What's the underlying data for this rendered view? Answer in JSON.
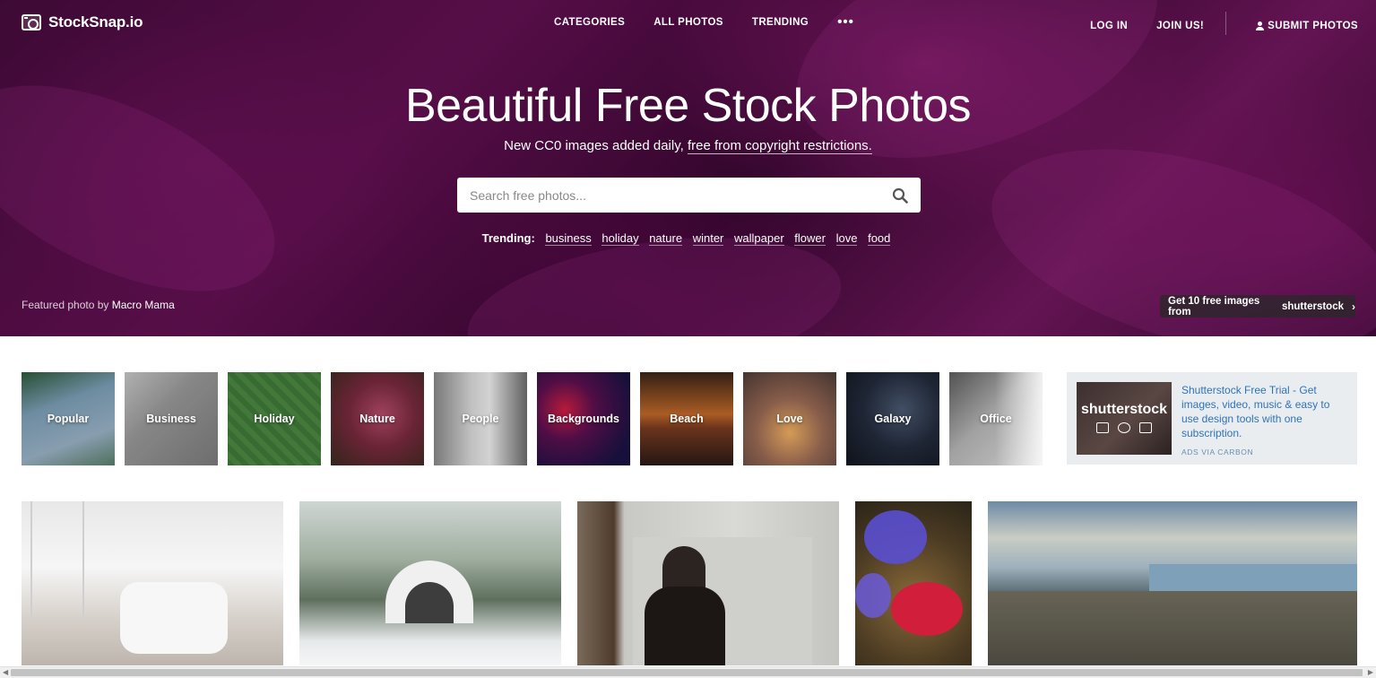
{
  "nav": {
    "logo": "StockSnap.io",
    "center": [
      "CATEGORIES",
      "ALL PHOTOS",
      "TRENDING"
    ],
    "more": "•••",
    "login": "LOG IN",
    "join": "JOIN US!",
    "submit": "SUBMIT PHOTOS"
  },
  "hero": {
    "title": "Beautiful Free Stock Photos",
    "subtitle_prefix": "New CC0 images added daily, ",
    "subtitle_link": "free from copyright restrictions.",
    "search_placeholder": "Search free photos...",
    "trending_label": "Trending:",
    "trending": [
      "business",
      "holiday",
      "nature",
      "winter",
      "wallpaper",
      "flower",
      "love",
      "food"
    ],
    "featured_prefix": "Featured photo by ",
    "featured_name": "Macro Mama",
    "shutterstock_cta": "Get 10 free images from",
    "shutterstock_brand": "shutterstock"
  },
  "categories": [
    "Popular",
    "Business",
    "Holiday",
    "Nature",
    "People",
    "Backgrounds",
    "Beach",
    "Love",
    "Galaxy",
    "Office"
  ],
  "ad": {
    "brand": "shutterstock",
    "text": "Shutterstock Free Trial - Get images, video, music & easy to use design tools with one subscription.",
    "via": "ADS VIA CARBON"
  },
  "colors": {
    "hero_bg": "#5a0f4c",
    "ad_link": "#2f73b8",
    "ad_bg": "#e9edf0"
  }
}
